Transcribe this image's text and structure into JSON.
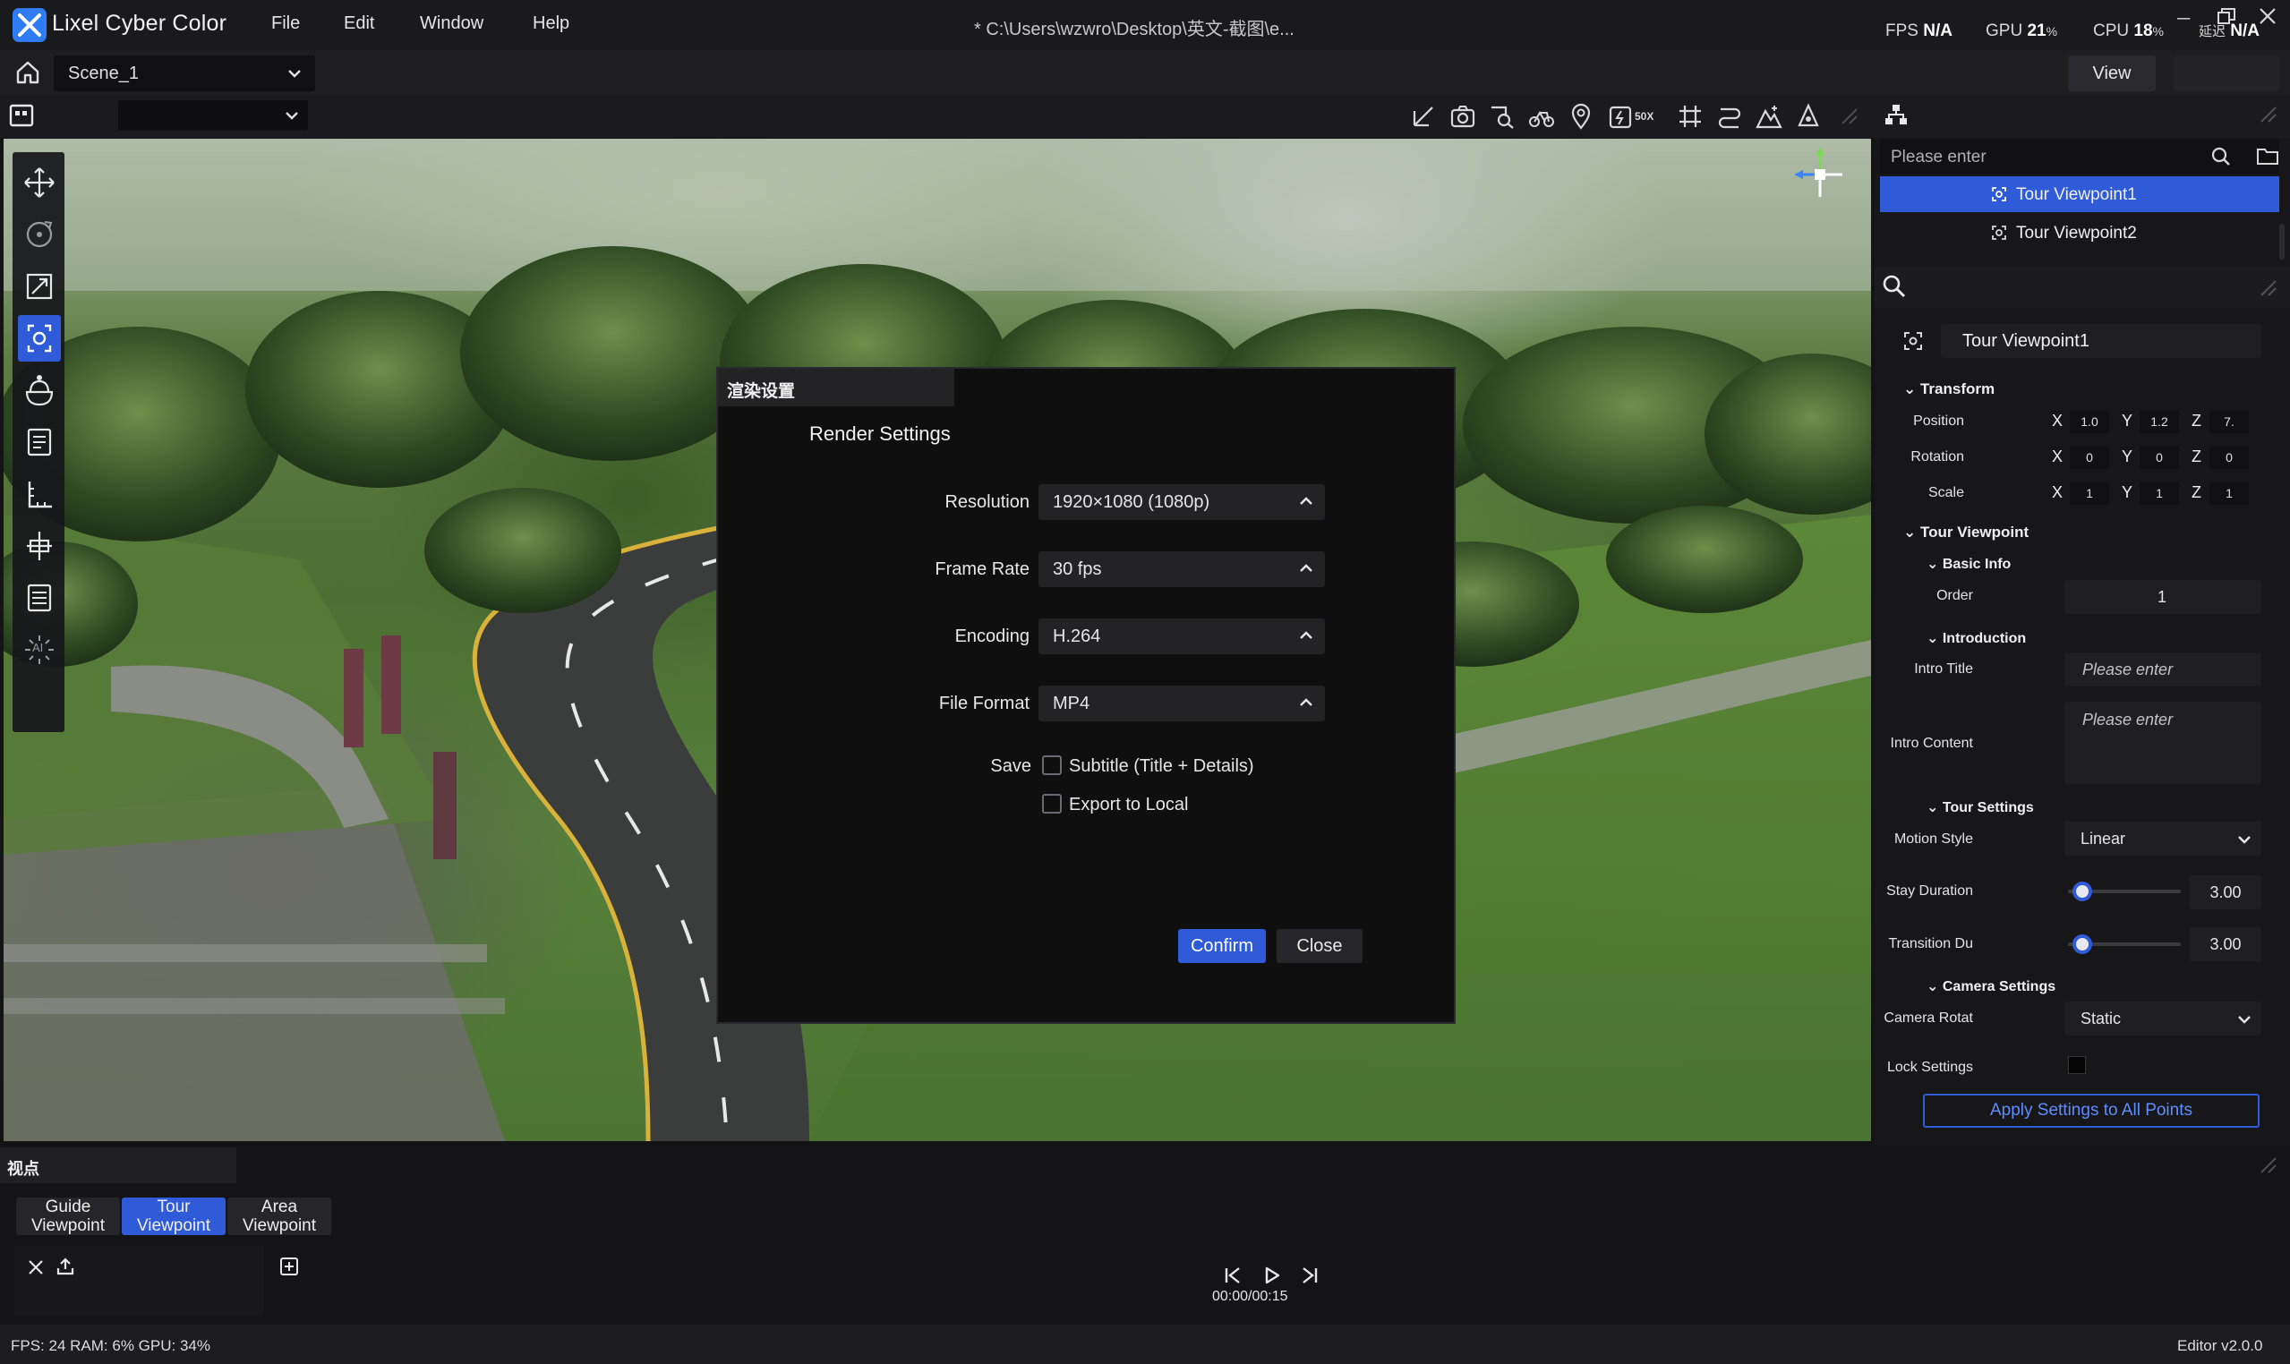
{
  "app": {
    "title": "Lixel Cyber Color",
    "file_path": "* C:\\Users\\wzwro\\Desktop\\英文-截图\\e...",
    "menu": [
      "File",
      "Edit",
      "Window",
      "Help"
    ],
    "perf": {
      "fps_label": "FPS",
      "fps_value": "N/A",
      "gpu_label": "GPU",
      "gpu_value": "21",
      "cpu_label": "CPU",
      "cpu_value": "18",
      "latency_label": "延迟",
      "latency_value": "N/A",
      "percent": "%"
    }
  },
  "scene": {
    "selected": "Scene_1",
    "view_button": "View"
  },
  "toolbar": {
    "icons": [
      "measure-icon",
      "camera-icon",
      "search-area-icon",
      "bicycle-icon",
      "location-pin-icon",
      "speed-50x-icon",
      "grid-icon",
      "path-icon",
      "terrain-icon",
      "light-icon"
    ],
    "speed_label": "50X"
  },
  "left_tools": {
    "icons": [
      "move-icon",
      "rotate-icon",
      "scale-icon",
      "viewpoint-icon",
      "helmet-icon",
      "notes-icon",
      "ruler-icon",
      "section-icon",
      "list-icon",
      "ai-icon"
    ],
    "active_index": 3,
    "ai_label": "AI"
  },
  "dialog": {
    "header": "渲染设置",
    "title": "Render Settings",
    "fields": [
      {
        "label": "Resolution",
        "value": "1920×1080 (1080p)"
      },
      {
        "label": "Frame Rate",
        "value": "30 fps"
      },
      {
        "label": "Encoding",
        "value": "H.264"
      },
      {
        "label": "File Format",
        "value": "MP4"
      }
    ],
    "save_label": "Save",
    "checkboxes": [
      {
        "label": "Subtitle (Title + Details)",
        "checked": false
      },
      {
        "label": "Export to Local",
        "checked": false
      }
    ],
    "confirm": "Confirm",
    "close": "Close"
  },
  "right_panel": {
    "search_placeholder": "Please enter",
    "viewpoints": [
      {
        "label": "Tour Viewpoint1",
        "selected": true
      },
      {
        "label": "Tour Viewpoint2",
        "selected": false
      }
    ],
    "selected_name": "Tour Viewpoint1",
    "transform": {
      "title": "Transform",
      "position": {
        "label": "Position",
        "x": "1.0",
        "y": "1.2",
        "z": "7."
      },
      "rotation": {
        "label": "Rotation",
        "x": "0",
        "y": "0",
        "z": "0"
      },
      "scale": {
        "label": "Scale",
        "x": "1",
        "y": "1",
        "z": "1"
      },
      "axes": [
        "X",
        "Y",
        "Z"
      ]
    },
    "tour_viewpoint": {
      "title": "Tour Viewpoint",
      "basic_info": "Basic Info",
      "order_label": "Order",
      "order_value": "1",
      "introduction": "Introduction",
      "intro_title_label": "Intro Title",
      "intro_title_placeholder": "Please enter",
      "intro_content_label": "Intro Content",
      "intro_content_placeholder": "Please enter",
      "tour_settings": "Tour Settings",
      "motion_style_label": "Motion Style",
      "motion_style_value": "Linear",
      "stay_duration_label": "Stay Duration",
      "stay_duration_value": "3.00",
      "stay_duration_fraction": 0.05,
      "transition_label": "Transition Du",
      "transition_value": "3.00",
      "transition_fraction": 0.05,
      "camera_settings": "Camera Settings",
      "camera_rotate_label": "Camera Rotat",
      "camera_rotate_value": "Static",
      "lock_settings_label": "Lock Settings",
      "apply_button": "Apply Settings to All Points"
    }
  },
  "bottom_panel": {
    "header": "视点",
    "tabs": [
      {
        "line1": "Guide",
        "line2": "Viewpoint",
        "active": false
      },
      {
        "line1": "Tour",
        "line2": "Viewpoint",
        "active": true
      },
      {
        "line1": "Area",
        "line2": "Viewpoint",
        "active": false
      }
    ],
    "time": "00:00/00:15"
  },
  "status": {
    "left": "FPS: 24  RAM: 6%  GPU: 34%",
    "right": "Editor v2.0.0"
  },
  "colors": {
    "accent": "#2f5bd8",
    "bg": "#141416",
    "panel": "#17171a"
  }
}
